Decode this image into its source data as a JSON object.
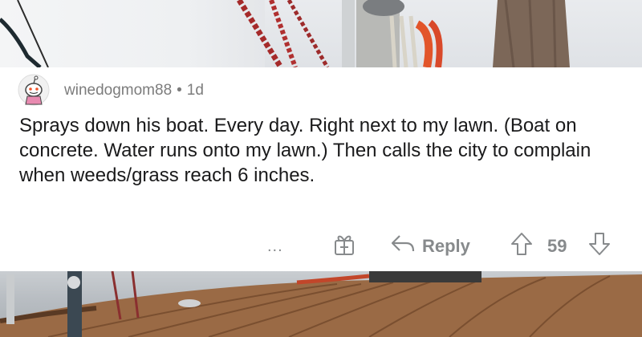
{
  "comment": {
    "username": "winedogmom88",
    "separator": "•",
    "age": "1d",
    "text": "Sprays down his boat. Every day. Right next to my lawn. (Boat on concrete. Water runs onto my lawn.) Then calls the city to complain when weeds/grass reach 6 inches."
  },
  "actions": {
    "more_label": "...",
    "reply_label": "Reply",
    "vote_count": "59"
  },
  "icons": {
    "avatar": "snoo-avatar-icon",
    "award": "gift-award-icon",
    "reply": "reply-arrow-icon",
    "upvote": "upvote-arrow-icon",
    "downvote": "downvote-arrow-icon"
  }
}
